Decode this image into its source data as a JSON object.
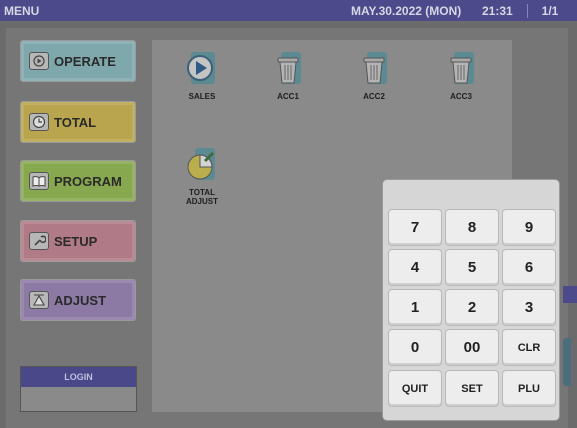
{
  "titlebar": {
    "title": "MENU",
    "date": "MAY.30.2022 (MON)",
    "time": "21:31",
    "page": "1/1"
  },
  "sidebar": {
    "items": [
      {
        "label": "OPERATE",
        "icon": "play-icon",
        "color": "#7fa8ad"
      },
      {
        "label": "TOTAL",
        "icon": "clock-icon",
        "color": "#b8a54e"
      },
      {
        "label": "PROGRAM",
        "icon": "book-icon",
        "color": "#88a850"
      },
      {
        "label": "SETUP",
        "icon": "wrench-icon",
        "color": "#b07b86"
      },
      {
        "label": "ADJUST",
        "icon": "scale-icon",
        "color": "#8c7aa4"
      }
    ],
    "login_label": "LOGIN"
  },
  "apps": [
    {
      "label": "SALES",
      "icon": "play-icon"
    },
    {
      "label": "ACC1",
      "icon": "trash-icon"
    },
    {
      "label": "ACC2",
      "icon": "trash-icon"
    },
    {
      "label": "ACC3",
      "icon": "trash-icon"
    },
    {
      "label": "TOTAL",
      "label2": "ADJUST",
      "icon": "pie-chart-icon"
    }
  ],
  "keypad": {
    "keys": [
      "7",
      "8",
      "9",
      "4",
      "5",
      "6",
      "1",
      "2",
      "3",
      "0",
      "00",
      "CLR",
      "QUIT",
      "SET",
      "PLU"
    ]
  }
}
